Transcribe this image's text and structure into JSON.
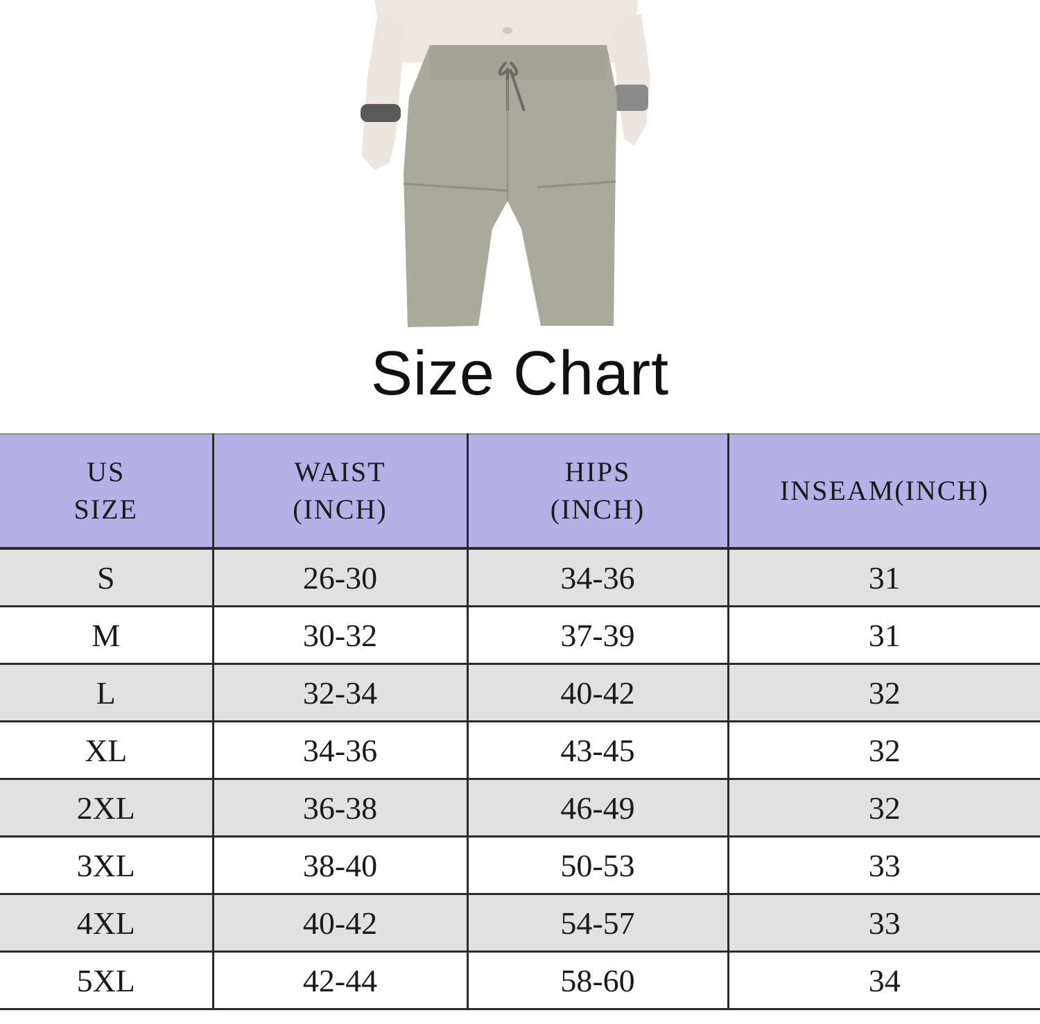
{
  "title": "Size Chart",
  "colors": {
    "header_bg": "#b7b0e6",
    "row_shade": "#e1e1e1",
    "shorts": "#a9aa9b"
  },
  "table": {
    "headers": [
      {
        "line1": "US",
        "line2": "SIZE"
      },
      {
        "line1": "WAIST",
        "line2": "(INCH)"
      },
      {
        "line1": "HIPS",
        "line2": "(INCH)"
      },
      {
        "line1": "INSEAM(INCH)",
        "line2": ""
      }
    ],
    "rows": [
      [
        "S",
        "26-30",
        "34-36",
        "31"
      ],
      [
        "M",
        "30-32",
        "37-39",
        "31"
      ],
      [
        "L",
        "32-34",
        "40-42",
        "32"
      ],
      [
        "XL",
        "34-36",
        "43-45",
        "32"
      ],
      [
        "2XL",
        "36-38",
        "46-49",
        "32"
      ],
      [
        "3XL",
        "38-40",
        "50-53",
        "33"
      ],
      [
        "4XL",
        "40-42",
        "54-57",
        "33"
      ],
      [
        "5XL",
        "42-44",
        "58-60",
        "34"
      ]
    ]
  }
}
